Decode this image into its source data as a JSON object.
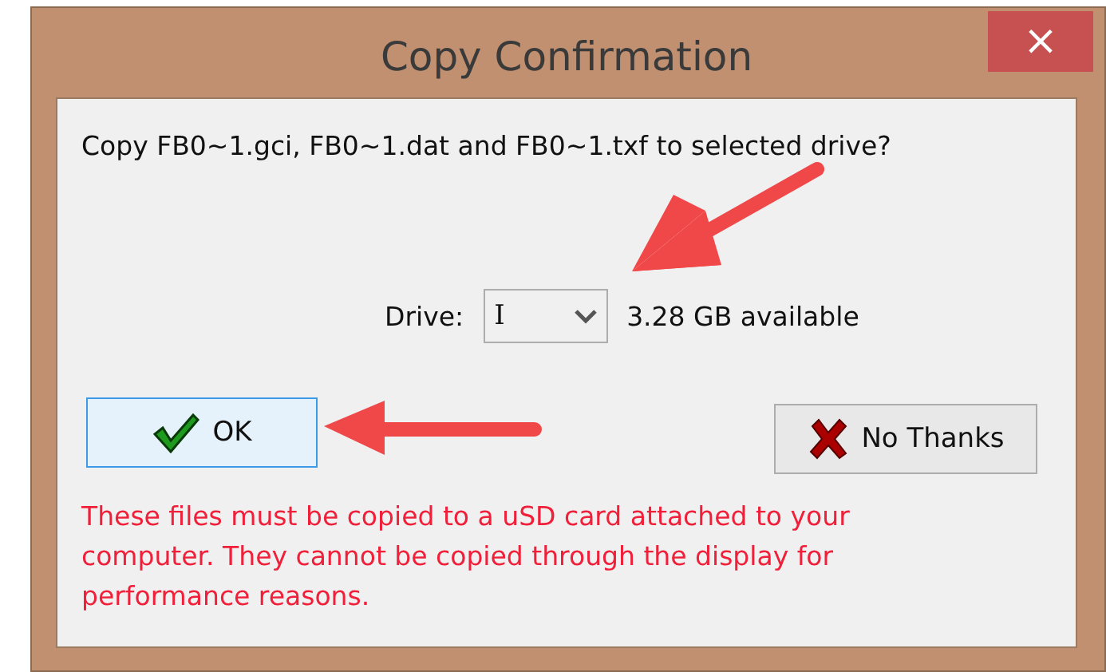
{
  "window": {
    "title": "Copy Confirmation",
    "close": "×"
  },
  "question": "Copy FB0~1.gci, FB0~1.dat and FB0~1.txf to selected drive?",
  "drive": {
    "label": "Drive:",
    "value": "I",
    "available": "3.28 GB available"
  },
  "buttons": [
    {
      "kind": "ok",
      "label": "OK",
      "focused": true
    },
    {
      "kind": "cancel",
      "label": "No Thanks",
      "focused": false
    }
  ],
  "warning": "These files must be copied to a uSD card attached to your computer. They cannot be copied through the display for performance reasons."
}
